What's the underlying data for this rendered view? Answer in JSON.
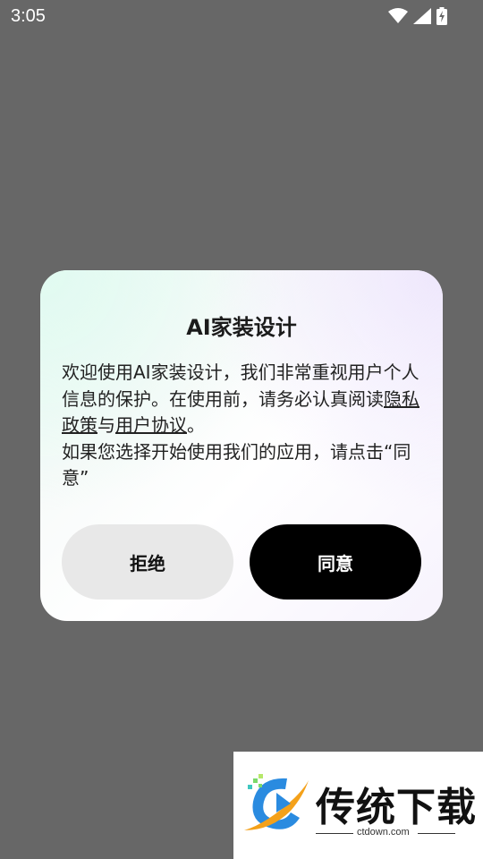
{
  "status_bar": {
    "time": "3:05",
    "icons": [
      "wifi-icon",
      "cellular-signal-icon",
      "battery-charging-icon"
    ]
  },
  "dialog": {
    "title": "AI家装设计",
    "body_part1": "欢迎使用AI家装设计，我们非常重视用户个人信息的保护。在使用前，请务必认真阅读",
    "privacy_link": "隐私政策",
    "connector": "与",
    "agreement_link": "用户协议",
    "body_end": "。",
    "body_part2": "如果您选择开始使用我们的应用，请点击“同意”",
    "reject_label": "拒绝",
    "agree_label": "同意"
  },
  "watermark": {
    "title": "传统下载",
    "url": "ctdown.com"
  },
  "colors": {
    "overlay": "#676767",
    "agree_button": "#000000",
    "reject_button": "#e8e8e8"
  }
}
